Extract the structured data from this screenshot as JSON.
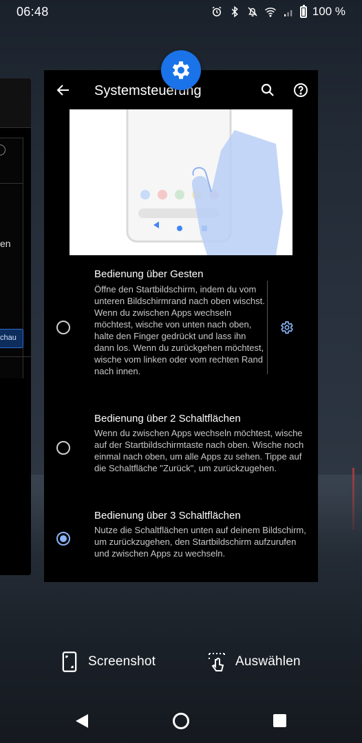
{
  "status_bar": {
    "time": "06:48",
    "battery": "100 %"
  },
  "left_card": {
    "partial_text": "en",
    "partial_button": "chau"
  },
  "settings_card": {
    "title": "Systemsteuerung",
    "options": [
      {
        "title": "Bedienung über Gesten",
        "description": "Öffne den Startbildschirm, indem du vom unteren Bildschirmrand nach oben wischst. Wenn du zwischen Apps wechseln möchtest, wische von unten nach oben, halte den Finger gedrückt und lass ihn dann los. Wenn du zurückgehen möchtest, wische vom linken oder vom rechten Rand nach innen.",
        "selected": false
      },
      {
        "title": "Bedienung über 2 Schaltflächen",
        "description": "Wenn du zwischen Apps wechseln möchtest, wische auf der Startbildschirmtaste nach oben. Wische noch einmal nach oben, um alle Apps zu sehen. Tippe auf die Schaltfläche \"Zurück\", um zurückzugehen.",
        "selected": false
      },
      {
        "title": "Bedienung über 3 Schaltflächen",
        "description": "Nutze die Schaltflächen unten auf deinem Bildschirm, um zurückzugehen, den Startbildschirm aufzurufen und zwischen Apps zu wechseln.",
        "selected": true
      }
    ]
  },
  "overview_actions": {
    "screenshot_label": "Screenshot",
    "select_label": "Auswählen"
  },
  "colors": {
    "accent": "#1a73e8",
    "radio_selected": "#8ab4f8",
    "card_background": "#000000"
  },
  "icons": {
    "app_badge": "settings-gear-icon",
    "toolbar": [
      "back-arrow-icon",
      "search-icon",
      "help-icon"
    ],
    "status": [
      "alarm-icon",
      "bluetooth-icon",
      "notifications-off-icon",
      "wifi-icon",
      "signal-icon",
      "battery-icon"
    ],
    "nav": [
      "nav-back-icon",
      "nav-home-icon",
      "nav-recents-icon"
    ]
  }
}
